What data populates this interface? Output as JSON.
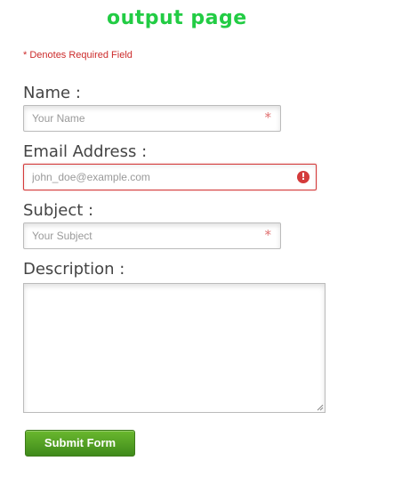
{
  "page": {
    "title": "output page",
    "required_note": "* Denotes Required Field"
  },
  "form": {
    "name": {
      "label": "Name :",
      "placeholder": "Your Name",
      "required_marker": "*"
    },
    "email": {
      "label": "Email Address :",
      "placeholder": "john_doe@example.com",
      "error_marker": "!"
    },
    "subject": {
      "label": "Subject :",
      "placeholder": "Your Subject",
      "required_marker": "*"
    },
    "description": {
      "label": "Description :"
    },
    "submit_label": "Submit Form"
  },
  "colors": {
    "title": "#22cc44",
    "required_note": "#cc2b2b",
    "error_border": "#d43b3b",
    "submit_button": "#4e9e22"
  }
}
